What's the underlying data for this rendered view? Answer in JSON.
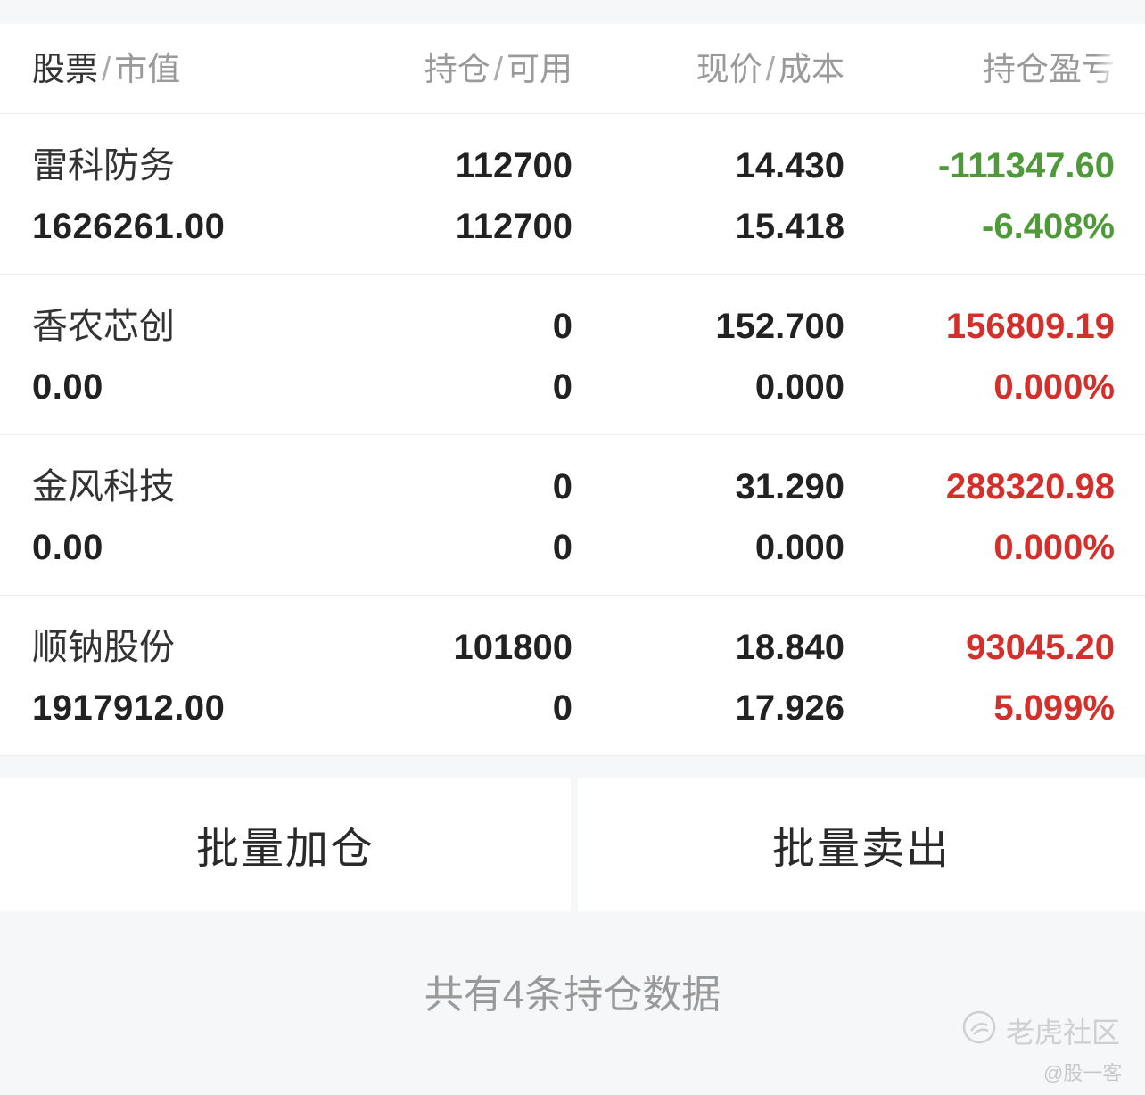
{
  "header": {
    "col1_primary": "股票",
    "col1_secondary": "市值",
    "col2_primary": "持仓",
    "col2_secondary": "可用",
    "col3_primary": "现价",
    "col3_secondary": "成本",
    "col4_primary": "持仓盈",
    "col4_fade": "亏",
    "separator": "/"
  },
  "positions": [
    {
      "name": "雷科防务",
      "market_value": "1626261.00",
      "holding": "112700",
      "available": "112700",
      "price": "14.430",
      "cost": "15.418",
      "pnl": "-111347.60",
      "pnl_pct": "-6.408%"
    },
    {
      "name": "香农芯创",
      "market_value": "0.00",
      "holding": "0",
      "available": "0",
      "price": "152.700",
      "cost": "0.000",
      "pnl": "156809.19",
      "pnl_pct": "0.000%"
    },
    {
      "name": "金风科技",
      "market_value": "0.00",
      "holding": "0",
      "available": "0",
      "price": "31.290",
      "cost": "0.000",
      "pnl": "288320.98",
      "pnl_pct": "0.000%"
    },
    {
      "name": "顺钠股份",
      "market_value": "1917912.00",
      "holding": "101800",
      "available": "0",
      "price": "18.840",
      "cost": "17.926",
      "pnl": "93045.20",
      "pnl_pct": "5.099%"
    }
  ],
  "actions": {
    "batch_add": "批量加仓",
    "batch_sell": "批量卖出"
  },
  "footer": {
    "summary": "共有4条持仓数据"
  },
  "watermark": {
    "brand": "老虎社区",
    "author": "@股一客"
  },
  "colors": {
    "loss": "#4e9a38",
    "gain": "#d3302c"
  }
}
